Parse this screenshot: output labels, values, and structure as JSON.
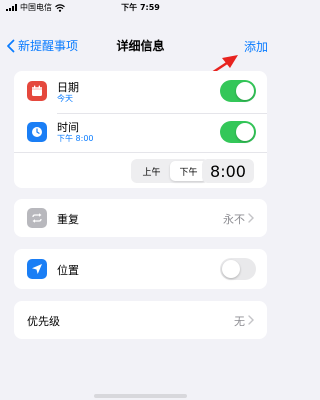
{
  "status_bar": {
    "carrier": "中国电信",
    "time": "下午 7:59"
  },
  "nav": {
    "back_label": "新提醒事项",
    "title": "详细信息",
    "add_label": "添加"
  },
  "date_time_card": {
    "date": {
      "title": "日期",
      "subtitle": "今天",
      "toggle_on": true,
      "icon": "calendar-icon",
      "icon_color": "#e5483d"
    },
    "time": {
      "title": "时间",
      "subtitle": "下午 8:00",
      "toggle_on": true,
      "icon": "clock-icon",
      "icon_color": "#1a7ef5"
    },
    "segmented": {
      "am": "上午",
      "pm": "下午",
      "selected": "下午"
    },
    "time_value": "8:00"
  },
  "repeat": {
    "title": "重复",
    "value": "永不",
    "icon": "repeat-icon",
    "icon_color": "#b8b8bd"
  },
  "location": {
    "title": "位置",
    "toggle_on": false,
    "icon": "location-arrow-icon",
    "icon_color": "#1a7ef5"
  },
  "priority": {
    "title": "优先级",
    "value": "无"
  },
  "colors": {
    "accent": "#0a7cff",
    "toggle_on": "#34c759",
    "annotation_arrow": "#e8231f"
  }
}
